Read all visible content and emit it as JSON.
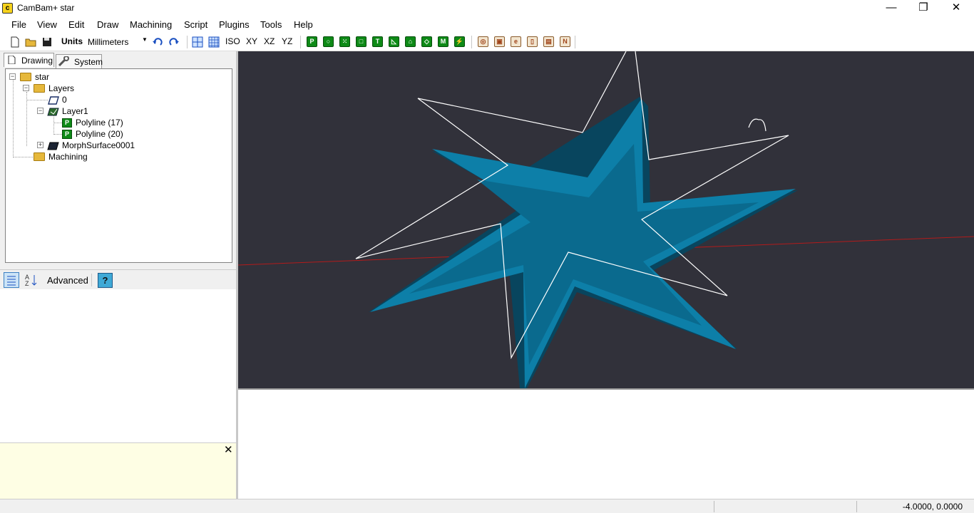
{
  "window": {
    "title": "CamBam+  star",
    "icon_label": "c",
    "minimize": "—",
    "maximize": "❐",
    "close": "✕"
  },
  "menu": [
    "File",
    "Edit",
    "Draw",
    "Machining",
    "Script",
    "Plugins",
    "Tools",
    "Help",
    "View"
  ],
  "menu_items": {
    "file": "File",
    "view": "View",
    "edit": "Edit",
    "draw": "Draw",
    "machining": "Machining",
    "script": "Script",
    "plugins": "Plugins",
    "tools": "Tools",
    "help": "Help"
  },
  "toolbar": {
    "units_label": "Units",
    "units_value": "Millimeters",
    "iso": "ISO",
    "xy": "XY",
    "xz": "XZ",
    "yz": "YZ"
  },
  "tabs": {
    "drawing": "Drawing",
    "system": "System"
  },
  "tree": {
    "root": "star",
    "layers": "Layers",
    "layer0": "0",
    "layer1": "Layer1",
    "polyline17": "Polyline (17)",
    "polyline20": "Polyline (20)",
    "morph": "MorphSurface0001",
    "machining": "Machining"
  },
  "props": {
    "advanced": "Advanced",
    "help_glyph": "?"
  },
  "help_close": "✕",
  "status": {
    "coords": "-4.0000, 0.0000"
  },
  "colors": {
    "viewport_bg": "#31313a",
    "star_fill": "#0d7fa8",
    "outline": "#ffffff",
    "axis_x": "#b31b1b"
  }
}
